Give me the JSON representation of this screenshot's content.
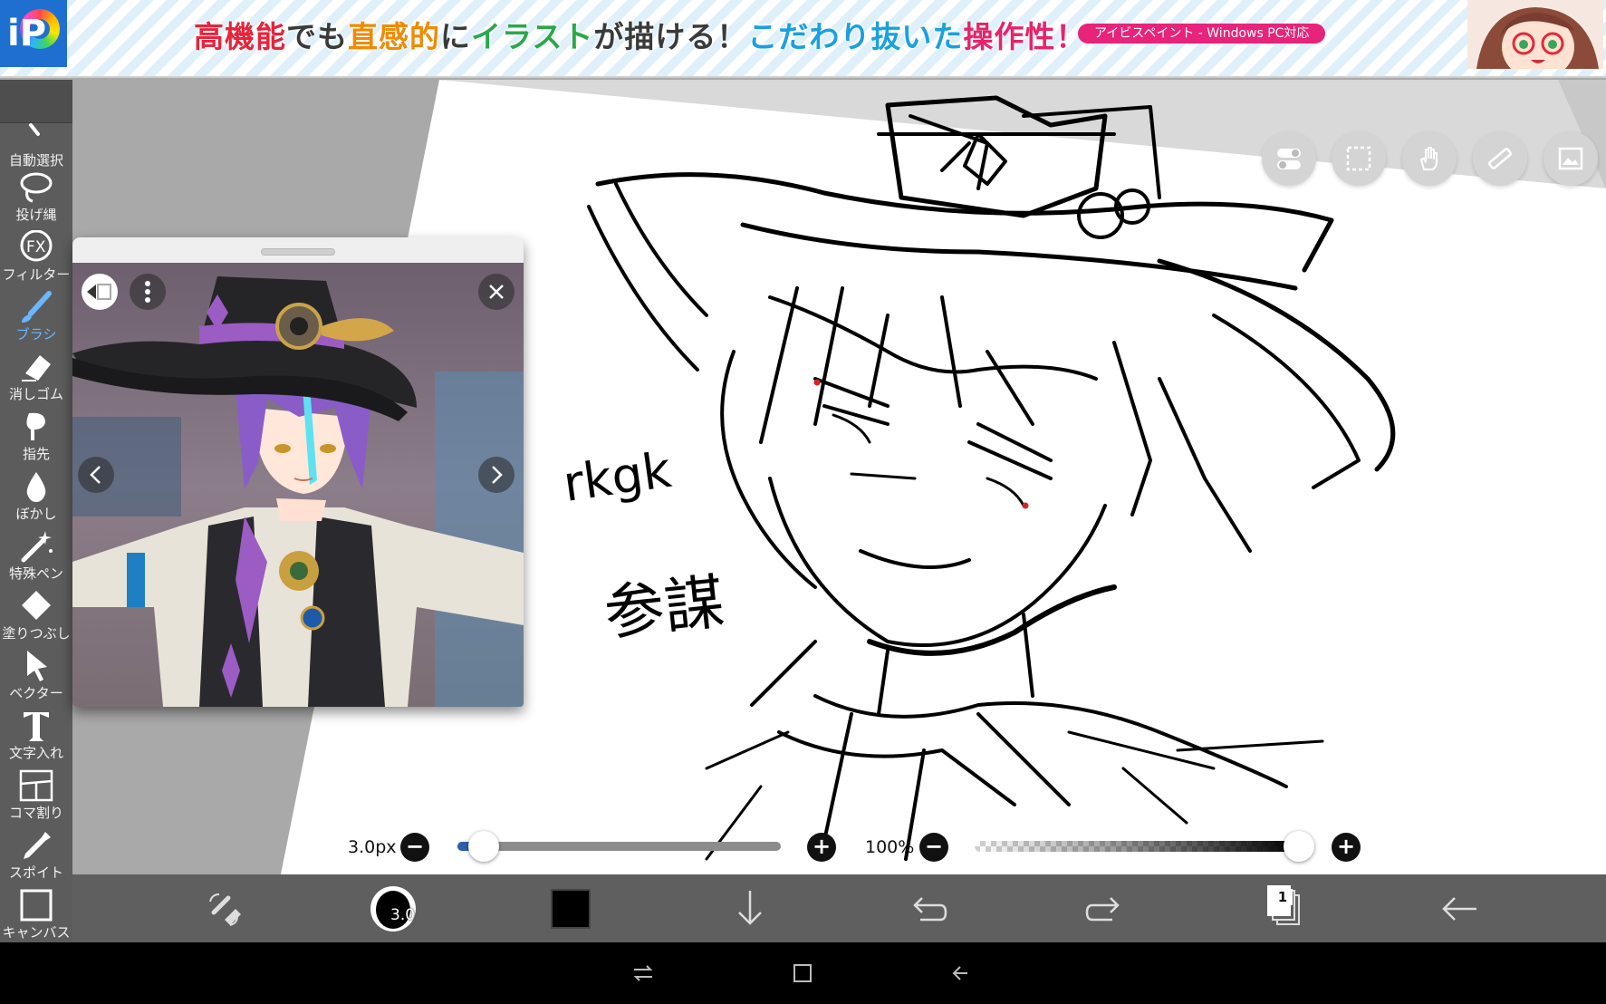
{
  "banner": {
    "logo_text": "iP",
    "headline": [
      {
        "text": "高機能",
        "color": "red"
      },
      {
        "text": "でも",
        "color": "dark"
      },
      {
        "text": "直感的",
        "color": "orange"
      },
      {
        "text": "に",
        "color": "dark"
      },
      {
        "text": "イラスト",
        "color": "green"
      },
      {
        "text": "が描ける！",
        "color": "dark"
      },
      {
        "text": "こだわり抜いた",
        "color": "blue"
      },
      {
        "text": "操作性！",
        "color": "pink"
      }
    ],
    "pill": "アイビスペイント - Windows PC対応"
  },
  "toolbar": {
    "items": [
      {
        "name": "magic-wand",
        "label": "自動選択",
        "icon": "magic-wand-icon"
      },
      {
        "name": "lasso",
        "label": "投げ縄",
        "icon": "lasso-icon"
      },
      {
        "name": "filter",
        "label": "フィルター",
        "icon": "fx-icon"
      },
      {
        "name": "brush",
        "label": "ブラシ",
        "icon": "brush-icon",
        "active": true
      },
      {
        "name": "eraser",
        "label": "消しゴム",
        "icon": "eraser-icon"
      },
      {
        "name": "smudge",
        "label": "指先",
        "icon": "finger-icon"
      },
      {
        "name": "blur",
        "label": "ぼかし",
        "icon": "drop-icon"
      },
      {
        "name": "special-pen",
        "label": "特殊ペン",
        "icon": "special-pen-icon"
      },
      {
        "name": "fill",
        "label": "塗りつぶし",
        "icon": "bucket-icon"
      },
      {
        "name": "vector",
        "label": "ベクター",
        "icon": "cursor-icon"
      },
      {
        "name": "text",
        "label": "文字入れ",
        "icon": "text-icon"
      },
      {
        "name": "frame-divider",
        "label": "コマ割り",
        "icon": "frame-icon"
      },
      {
        "name": "eyedropper",
        "label": "スポイト",
        "icon": "eyedropper-icon"
      },
      {
        "name": "canvas",
        "label": "キャンバス",
        "icon": "canvas-icon"
      }
    ]
  },
  "canvas": {
    "handwriting_1": "rkgk",
    "handwriting_2": "参謀"
  },
  "sliders": {
    "brush_size": "3.0px",
    "brush_size_fraction": 0.08,
    "opacity": "100%",
    "opacity_fraction": 1.0
  },
  "action_bar": {
    "brush_value": "3.0",
    "color": "#000000",
    "layer_count": "1"
  },
  "colors": {
    "accent": "#2c5fae",
    "active_tool": "#6ab7ff",
    "toolbar_bg": "#5c5c5c",
    "action_bar_bg": "#5f5f5f"
  }
}
